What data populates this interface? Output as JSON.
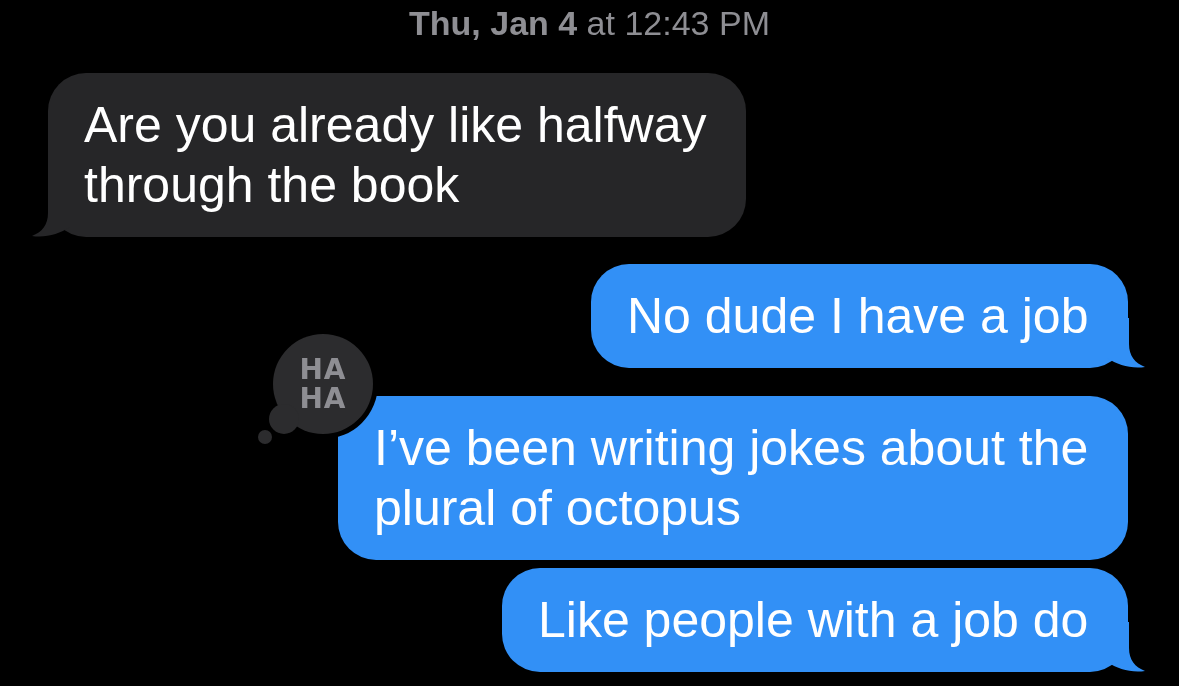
{
  "timestamp": "**Thu, Jan 4** at 12:43 PM",
  "messages": [
    {
      "kind": "incoming",
      "text": "Are you already like halfway through the book",
      "tail": true
    },
    {
      "kind": "outgoing",
      "text": "No dude I have a job",
      "tail": true
    },
    {
      "kind": "outgoing",
      "text": "I’ve been writing jokes about the plural of octopus",
      "tail": false,
      "reaction": {
        "text": "HA HA"
      }
    },
    {
      "kind": "outgoing",
      "text": "Like people with a job do",
      "tail": true
    }
  ]
}
